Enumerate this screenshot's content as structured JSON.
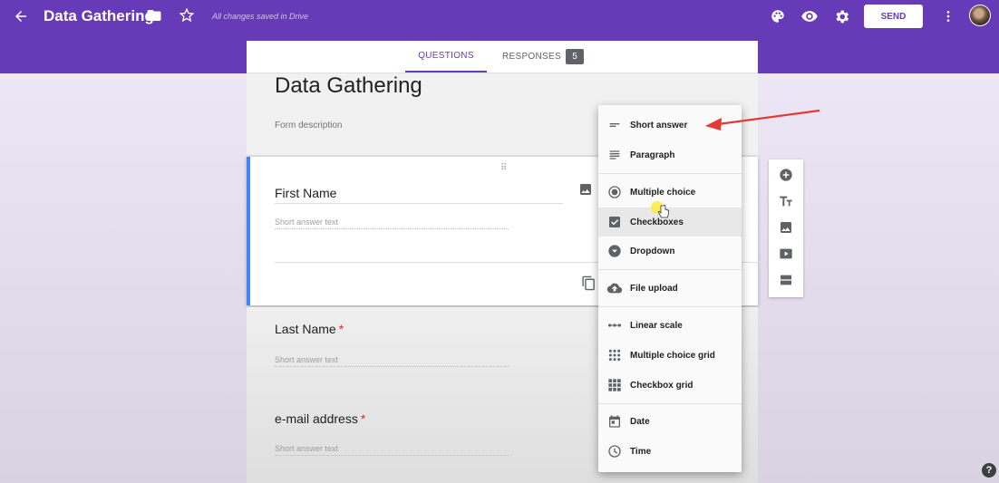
{
  "header": {
    "title": "Data Gathering",
    "saved_status": "All changes saved in Drive",
    "send_label": "SEND"
  },
  "tabs": {
    "questions": "QUESTIONS",
    "responses": "RESPONSES",
    "responses_count": "5"
  },
  "form": {
    "title": "Data Gathering",
    "description_placeholder": "Form description"
  },
  "questions": [
    {
      "title": "First Name",
      "hint": "Short answer text",
      "required": false
    },
    {
      "title": "Last Name",
      "hint": "Short answer text",
      "required": true,
      "required_mark": "*"
    },
    {
      "title": "e-mail address",
      "hint": "Short answer text",
      "required": true,
      "required_mark": "*"
    }
  ],
  "question_type_menu": {
    "items": [
      {
        "label": "Short answer",
        "icon": "short-answer-icon"
      },
      {
        "label": "Paragraph",
        "icon": "paragraph-icon"
      },
      {
        "label": "Multiple choice",
        "icon": "radio-icon"
      },
      {
        "label": "Checkboxes",
        "icon": "checkbox-icon",
        "highlighted": true
      },
      {
        "label": "Dropdown",
        "icon": "dropdown-icon"
      },
      {
        "label": "File upload",
        "icon": "cloud-upload-icon"
      },
      {
        "label": "Linear scale",
        "icon": "linear-scale-icon"
      },
      {
        "label": "Multiple choice grid",
        "icon": "grid-dots-icon"
      },
      {
        "label": "Checkbox grid",
        "icon": "grid-squares-icon"
      },
      {
        "label": "Date",
        "icon": "calendar-icon"
      },
      {
        "label": "Time",
        "icon": "clock-icon"
      }
    ]
  },
  "sidebar_tools": [
    "add-question-icon",
    "add-title-icon",
    "add-image-icon",
    "add-video-icon",
    "add-section-icon"
  ],
  "help_label": "?",
  "colors": {
    "accent": "#673ab7",
    "active_border": "#4285f4",
    "required": "#d93025",
    "annotation_arrow": "#e53935"
  }
}
